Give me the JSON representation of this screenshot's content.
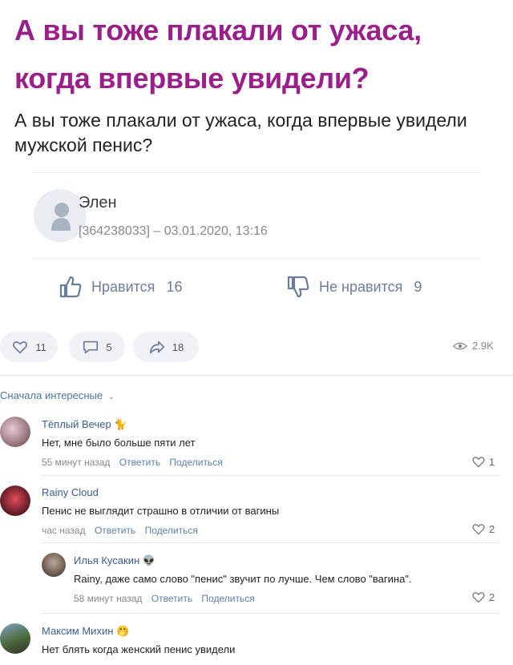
{
  "post": {
    "title": "А вы тоже плакали от ужаса, когда впервые увидели?",
    "question": "А вы тоже плакали от ужаса, когда впервые увидели мужской пенис?",
    "author": {
      "name": "Элен",
      "meta": "[364238033] – 03.01.2020, 13:16",
      "avatar_icon": "user-silhouette-icon"
    },
    "votes": {
      "like_label": "Нравится",
      "like_count": "16",
      "dislike_label": "Не нравится",
      "dislike_count": "9"
    },
    "actions": {
      "likes": "11",
      "comments": "5",
      "shares": "18",
      "views": "2.9K"
    }
  },
  "comments_section": {
    "sort_label": "Сначала интересные",
    "comments": [
      {
        "name": "Тёплый Вечер 🐈",
        "text": "Нет, мне было больше пяти лет",
        "time": "55 минут назад",
        "reply": "Ответить",
        "share": "Поделиться",
        "likes": "1"
      },
      {
        "name": "Rainy Cloud",
        "text": "Пенис не выглядит страшно в отличии от вагины",
        "time": "час назад",
        "reply": "Ответить",
        "share": "Поделиться",
        "likes": "2"
      },
      {
        "name": "Илья Кусакин 👽",
        "text": "Rainy, даже само слово \"пенис\" звучит по лучше. Чем слово \"вагина\".",
        "time": "58 минут назад",
        "reply": "Ответить",
        "share": "Поделиться",
        "likes": "2"
      },
      {
        "name": "Максим Михин 🤭",
        "text": "Нет блять когда женский пенис увидели"
      }
    ]
  },
  "colors": {
    "title": "#9b1f8b",
    "link": "#4a76a8",
    "vote": "#6b7d99"
  }
}
